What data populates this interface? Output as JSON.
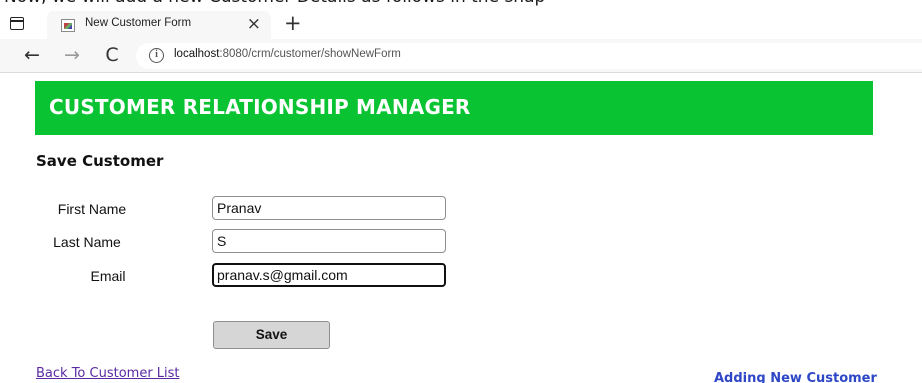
{
  "caption": "Now, we will add a new Customer Details as follows in the snap",
  "browser": {
    "tab_title": "New Customer Form",
    "tab_close": "×",
    "new_tab": "+",
    "url_host": "localhost",
    "url_rest": ":8080/crm/customer/showNewForm",
    "info_icon": "i",
    "back_icon": "←",
    "forward_icon": "→",
    "reload_icon": "C"
  },
  "app": {
    "header_title": "CUSTOMER RELATIONSHIP MANAGER",
    "header_color": "#09c332"
  },
  "form": {
    "title": "Save Customer",
    "fields": [
      {
        "label": "First Name",
        "value": "Pranav"
      },
      {
        "label": "Last Name",
        "value": "S"
      },
      {
        "label": "Email",
        "value": "pranav.s@gmail.com"
      }
    ],
    "save_label": "Save"
  },
  "footer": {
    "back_link": "Back To Customer List",
    "status": "Adding New Customer"
  }
}
